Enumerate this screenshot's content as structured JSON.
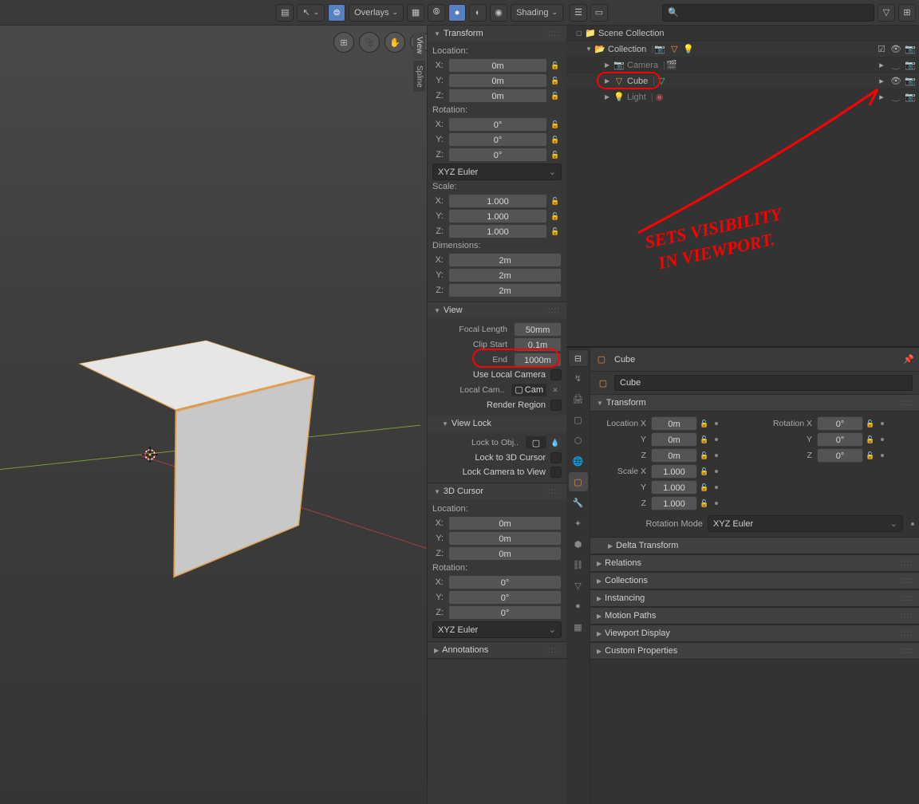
{
  "header": {
    "overlays": "Overlays",
    "shading": "Shading"
  },
  "side_tabs": {
    "view": "View",
    "spline": "Spline"
  },
  "transform": {
    "title": "Transform",
    "location_label": "Location:",
    "loc": {
      "x": "0m",
      "y": "0m",
      "z": "0m"
    },
    "rotation_label": "Rotation:",
    "rot": {
      "x": "0°",
      "y": "0°",
      "z": "0°"
    },
    "rot_mode": "XYZ Euler",
    "scale_label": "Scale:",
    "scale": {
      "x": "1.000",
      "y": "1.000",
      "z": "1.000"
    },
    "dim_label": "Dimensions:",
    "dim": {
      "x": "2m",
      "y": "2m",
      "z": "2m"
    }
  },
  "view": {
    "title": "View",
    "focal_label": "Focal Length",
    "focal": "50mm",
    "clip_start_label": "Clip Start",
    "clip_start": "0.1m",
    "clip_end_label": "End",
    "clip_end": "1000m",
    "local_camera": "Use Local Camera",
    "local_cam_label": "Local Cam..",
    "local_cam_val": "Cam",
    "render_region": "Render Region",
    "view_lock": "View Lock",
    "lock_obj": "Lock to Obj..",
    "lock_cursor": "Lock to 3D Cursor",
    "lock_cam_view": "Lock Camera to View"
  },
  "cursor3d": {
    "title": "3D Cursor",
    "location_label": "Location:",
    "loc": {
      "x": "0m",
      "y": "0m",
      "z": "0m"
    },
    "rotation_label": "Rotation:",
    "rot": {
      "x": "0°",
      "y": "0°",
      "z": "0°"
    },
    "rot_mode": "XYZ Euler"
  },
  "annotations_title": "Annotations",
  "outliner": {
    "scene": "Scene Collection",
    "collection": "Collection",
    "camera": "Camera",
    "cube": "Cube",
    "light": "Light"
  },
  "props": {
    "breadcrumb": "Cube",
    "name": "Cube",
    "transform_title": "Transform",
    "locx": "Location X",
    "loc": {
      "x": "0m",
      "y": "0m",
      "z": "0m"
    },
    "rotx": "Rotation X",
    "rot": {
      "x": "0°",
      "y": "0°",
      "z": "0°"
    },
    "scalex": "Scale X",
    "scale": {
      "x": "1.000",
      "y": "1.000",
      "z": "1.000"
    },
    "rot_mode_label": "Rotation Mode",
    "rot_mode": "XYZ Euler",
    "y": "Y",
    "z": "Z",
    "delta": "Delta Transform",
    "relations": "Relations",
    "collections": "Collections",
    "instancing": "Instancing",
    "motion_paths": "Motion Paths",
    "viewport_display": "Viewport Display",
    "custom": "Custom Properties"
  },
  "annotation_text": "SETS VISIBILITY IN VIEWPORT."
}
